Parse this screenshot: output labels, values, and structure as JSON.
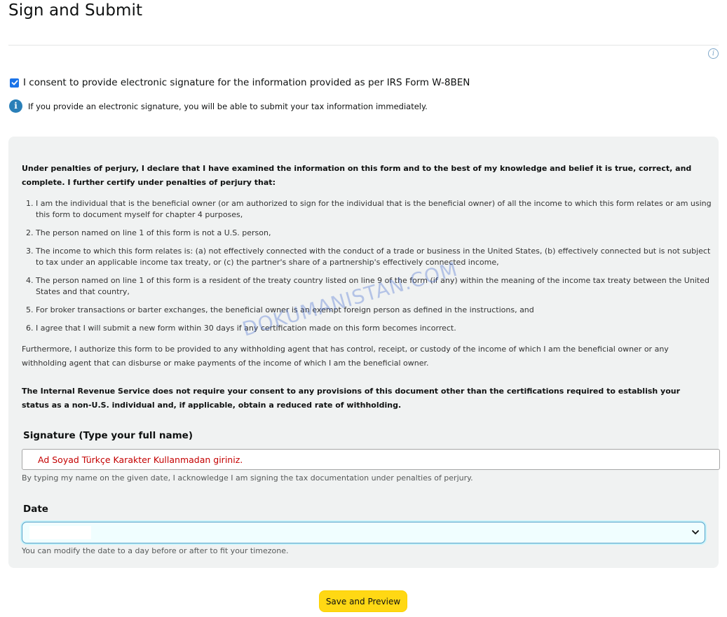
{
  "page": {
    "title": "Sign and Submit"
  },
  "consent": {
    "checked": true,
    "label": "I consent to provide electronic signature for the information provided as per IRS Form W-8BEN"
  },
  "alert": {
    "icon": "info-icon",
    "text": "If you provide an electronic signature, you will be able to submit your tax information immediately."
  },
  "declaration": {
    "intro": "Under penalties of perjury, I declare that I have examined the information on this form and to the best of my knowledge and belief it is true, correct, and complete. I further certify under penalties of perjury that:",
    "items": [
      "I am the individual that is the beneficial owner (or am authorized to sign for the individual that is the beneficial owner) of all the income to which this form relates or am using this form to document myself for chapter 4 purposes,",
      "The person named on line 1 of this form is not a U.S. person,",
      "The income to which this form relates is: (a) not effectively connected with the conduct of a trade or business in the United States, (b) effectively connected but is not subject to tax under an applicable income tax treaty, or (c) the partner's share of a partnership's effectively connected income,",
      "The person named on line 1 of this form is a resident of the treaty country listed on line 9 of the form (if any) within the meaning of the income tax treaty between the United States and that country,",
      "For broker transactions or barter exchanges, the beneficial owner is an exempt foreign person as defined in the instructions, and",
      "I agree that I will submit a new form within 30 days if any certification made on this form becomes incorrect."
    ],
    "furthermore": "Furthermore, I authorize this form to be provided to any withholding agent that has control, receipt, or custody of the income of which I am the beneficial owner or any withholding agent that can disburse or make payments of the income of which I am the beneficial owner.",
    "irs_note": "The Internal Revenue Service does not require your consent to any provisions of this document other than the certifications required to establish your status as a non-U.S. individual and, if applicable, obtain a reduced rate of withholding."
  },
  "watermark": "DOKUMANISTAN.COM",
  "signature": {
    "label": "Signature (Type your full name)",
    "value": "Ad Soyad Türkçe Karakter Kullanmadan giriniz.",
    "help": "By typing my name on the given date, I acknowledge I am signing the tax documentation under penalties of perjury."
  },
  "date": {
    "label": "Date",
    "value": "",
    "help": "You can modify the date to a day before or after to fit your timezone."
  },
  "actions": {
    "save_label": "Save and Preview"
  },
  "colors": {
    "accent_button": "#ffd814",
    "checkbox": "#1a73e8",
    "info": "#2a7fb8",
    "signature_text": "#c40000"
  }
}
